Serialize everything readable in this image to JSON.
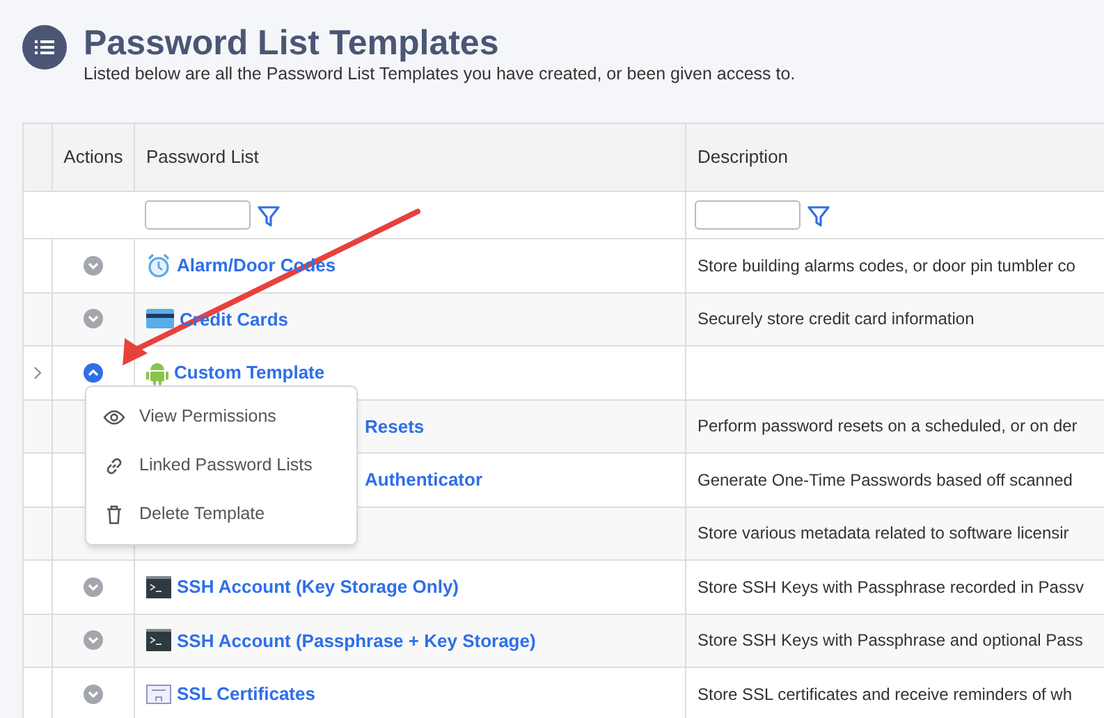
{
  "header": {
    "title": "Password List Templates",
    "subtitle": "Listed below are all the Password List Templates you have created, or been given access to."
  },
  "table": {
    "columns": [
      "Actions",
      "Password List",
      "Description"
    ],
    "rows": [
      {
        "kind": "alarm",
        "name": "Alarm/Door Codes",
        "description": "Store building alarms codes, or door pin tumbler co",
        "menu_open": false
      },
      {
        "kind": "card",
        "name": "Credit Cards",
        "description": "Securely store credit card information",
        "menu_open": false
      },
      {
        "kind": "android",
        "name": "Custom Template",
        "menu_open": true
      },
      {
        "kind": "covered",
        "name": "Resets",
        "description": "Perform password resets on a scheduled, or on der"
      },
      {
        "kind": "covered",
        "name": "Authenticator",
        "description": "Generate One-Time Passwords based off scanned"
      },
      {
        "kind": "covered",
        "description": "Store various metadata related to software licensir"
      },
      {
        "kind": "terminal",
        "name": "SSH Account (Key Storage Only)",
        "description": "Store SSH Keys with Passphrase recorded in Passv",
        "menu_open": false
      },
      {
        "kind": "terminal",
        "name": "SSH Account (Passphrase + Key Storage)",
        "description": "Store SSH Keys with Passphrase and optional Pass",
        "menu_open": false
      },
      {
        "kind": "certificate",
        "name": "SSL Certificates",
        "description": "Store SSL certificates and receive reminders of wh",
        "menu_open": false
      }
    ]
  },
  "action_menu": {
    "items": [
      {
        "label": "View Permissions"
      },
      {
        "label": "Linked Password Lists"
      },
      {
        "label": "Delete Template"
      }
    ]
  }
}
